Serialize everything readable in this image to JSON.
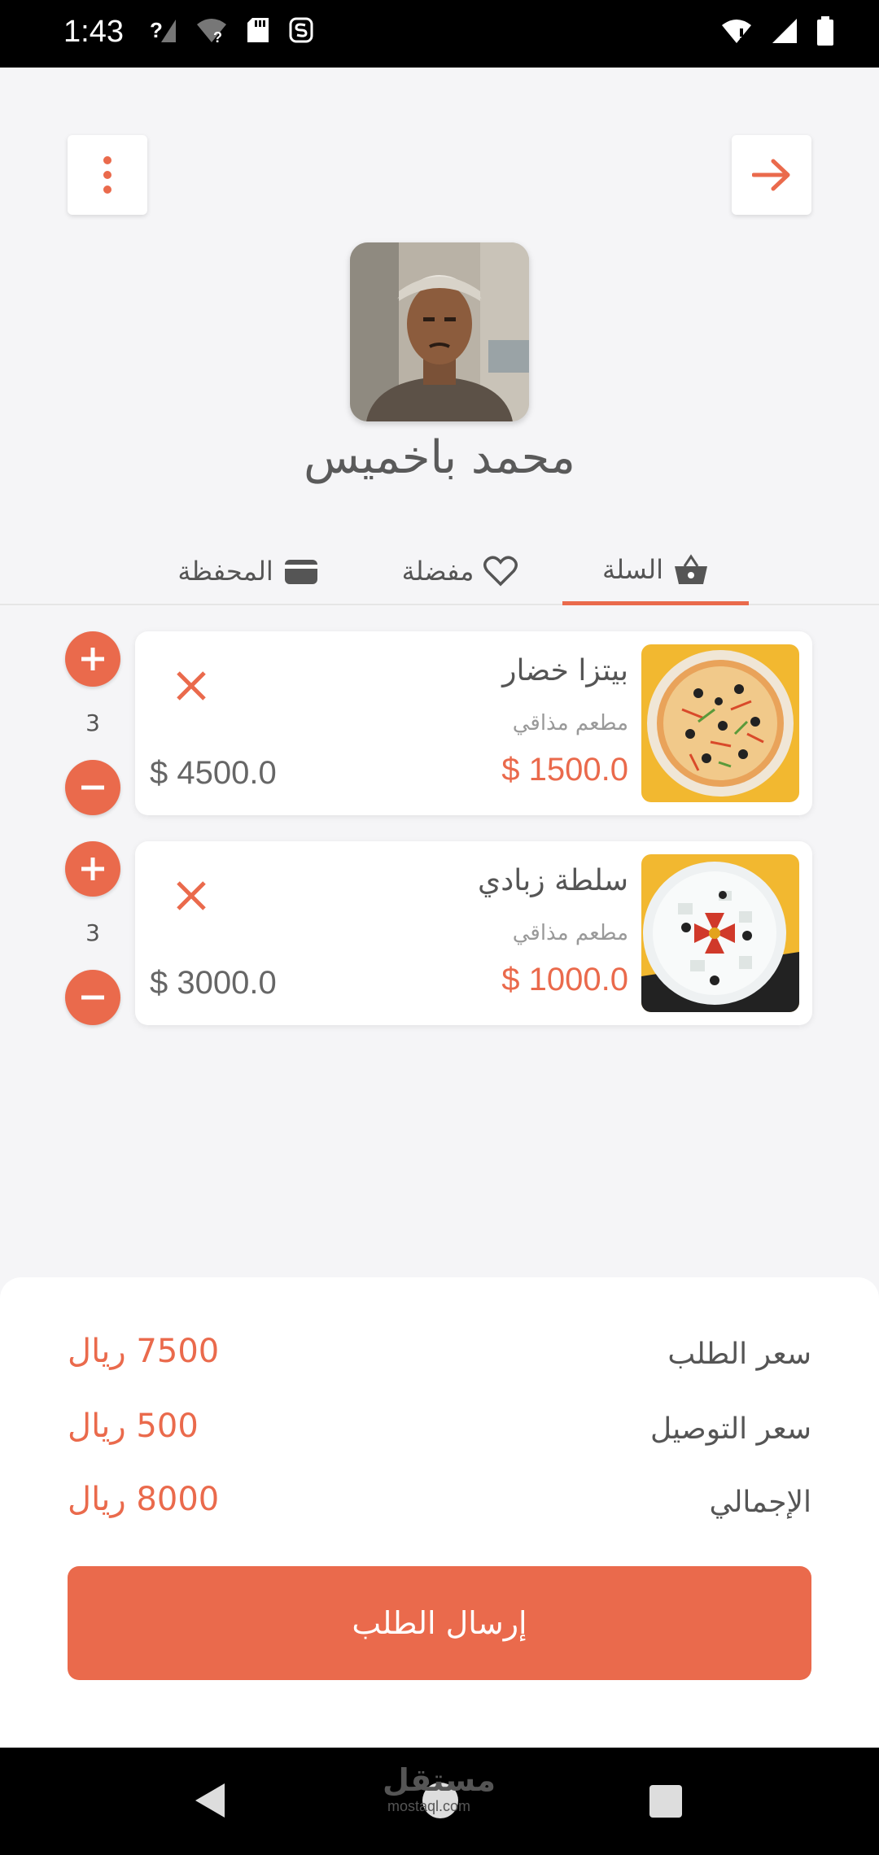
{
  "status_bar": {
    "time": "1:43"
  },
  "header": {
    "menu_icon": "more-vertical-icon",
    "back_icon": "arrow-right-icon"
  },
  "profile": {
    "name": "محمد باخميس"
  },
  "tabs": [
    {
      "label": "السلة",
      "icon": "basket-icon",
      "active": true
    },
    {
      "label": "مفضلة",
      "icon": "heart-icon",
      "active": false
    },
    {
      "label": "المحفظة",
      "icon": "wallet-icon",
      "active": false
    }
  ],
  "cart": {
    "items": [
      {
        "title": "بيتزا خضار",
        "restaurant": "مطعم مذاقي",
        "price": "$ 1500.0",
        "quantity": "3",
        "total": "$ 4500.0"
      },
      {
        "title": "سلطة زبادي",
        "restaurant": "مطعم مذاقي",
        "price": "$ 1000.0",
        "quantity": "3",
        "total": "$ 3000.0"
      }
    ]
  },
  "summary": {
    "order_price_label": "سعر الطلب",
    "order_price_value": "7500 ريال",
    "delivery_label": "سعر التوصيل",
    "delivery_value": "500 ريال",
    "total_label": "الإجمالي",
    "total_value": "8000 ريال",
    "submit_label": "إرسال الطلب"
  },
  "watermark": {
    "text": "مستقل",
    "sub": "mostaql.com"
  },
  "colors": {
    "accent": "#ea6a4c",
    "background": "#f5f5f7"
  }
}
